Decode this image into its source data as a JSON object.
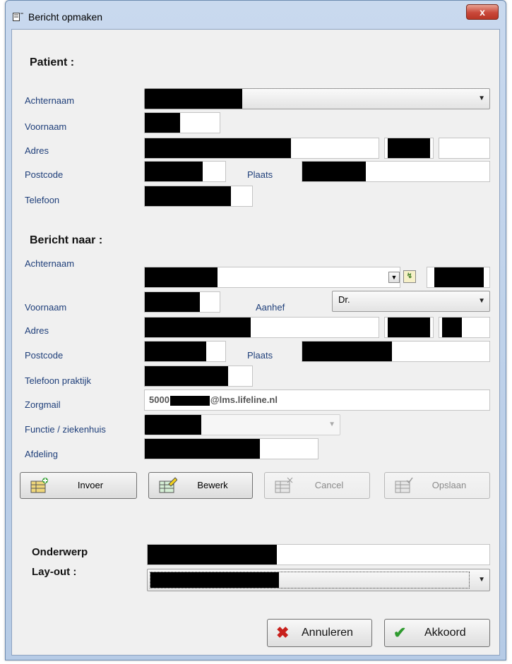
{
  "window": {
    "title": "Bericht opmaken",
    "close_glyph": "x"
  },
  "patient": {
    "heading": "Patient :",
    "labels": {
      "achternaam": "Achternaam",
      "voornaam": "Voornaam",
      "adres": "Adres",
      "postcode": "Postcode",
      "plaats": "Plaats",
      "telefoon": "Telefoon"
    }
  },
  "recipient": {
    "heading": "Bericht naar :",
    "labels": {
      "achternaam": "Achternaam",
      "voornaam": "Voornaam",
      "aanhef": "Aanhef",
      "adres": "Adres",
      "postcode": "Postcode",
      "plaats": "Plaats",
      "telefoon": "Telefoon praktijk",
      "zorgmail": "Zorgmail",
      "functie": "Functie / ziekenhuis",
      "afdeling": "Afdeling"
    },
    "aanhef_value": "Dr.",
    "zorgmail_prefix": "5000",
    "zorgmail_suffix": "@lms.lifeline.nl"
  },
  "actions": {
    "invoer": "Invoer",
    "bewerk": "Bewerk",
    "cancel": "Cancel",
    "opslaan": "Opslaan"
  },
  "footer": {
    "onderwerp_label": "Onderwerp",
    "layout_label": "Lay-out :",
    "annuleren": "Annuleren",
    "akkoord": "Akkoord"
  },
  "icons": {
    "title": "window-icon",
    "close": "close-icon",
    "dropdown": "chevron-down-icon",
    "lookup": "lookup-icon",
    "cancel": "red-x-icon",
    "ok": "green-check-icon"
  },
  "colors": {
    "label_blue": "#1f3f7a",
    "close_red": "#c9483a",
    "check_green": "#2e9a2e",
    "x_red": "#c8201c"
  }
}
